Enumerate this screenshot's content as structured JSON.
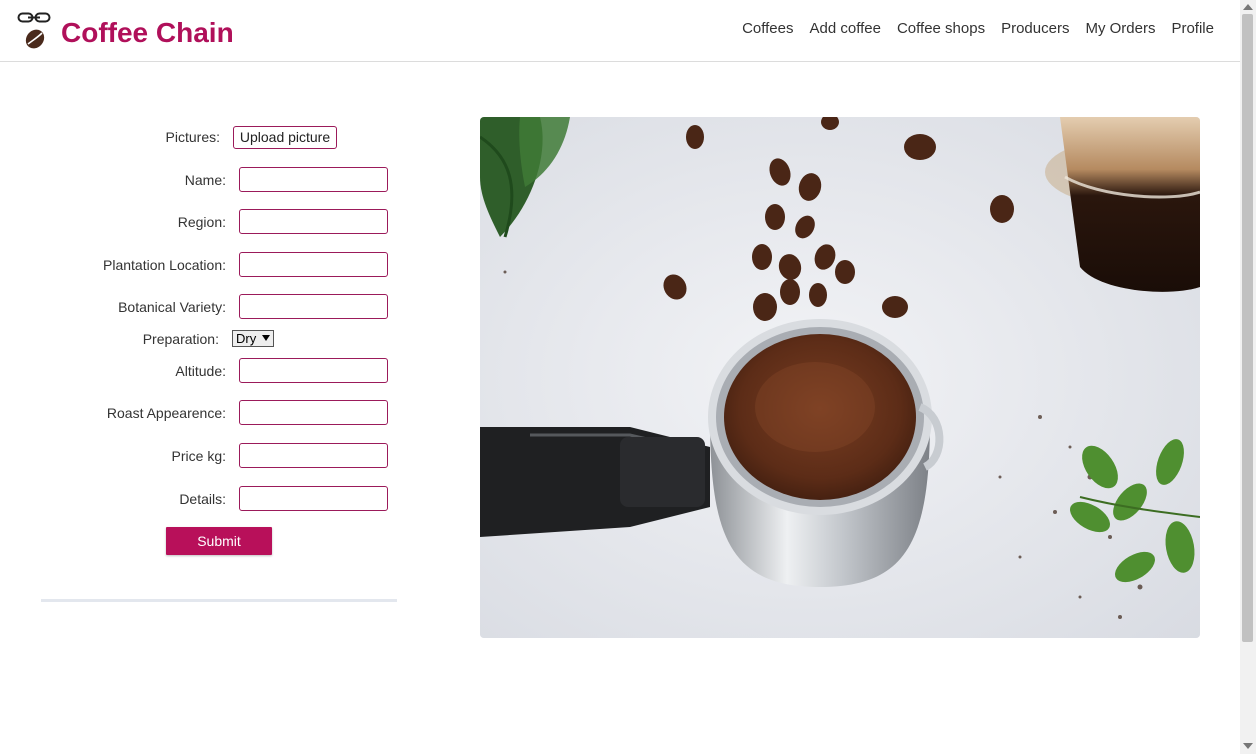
{
  "header": {
    "brand": "Coffee Chain",
    "nav": [
      "Coffees",
      "Add coffee",
      "Coffee shops",
      "Producers",
      "My Orders",
      "Profile"
    ],
    "brand_color": "#b0105a"
  },
  "form": {
    "pictures_label": "Pictures:",
    "upload_label": "Upload picture",
    "fields": [
      {
        "label": "Name:",
        "value": ""
      },
      {
        "label": "Region:",
        "value": ""
      },
      {
        "label": "Plantation Location:",
        "value": ""
      },
      {
        "label": "Botanical Variety:",
        "value": ""
      }
    ],
    "preparation_label": "Preparation:",
    "preparation_value": "Dry",
    "fields2": [
      {
        "label": "Altitude:",
        "value": ""
      },
      {
        "label": "Roast Appearence:",
        "value": ""
      },
      {
        "label": "Price kg:",
        "value": ""
      },
      {
        "label": "Details:",
        "value": ""
      }
    ],
    "submit_label": "Submit",
    "accent_color": "#b8105a"
  },
  "photo": {
    "icon": "coffee-portafilter-photo"
  }
}
